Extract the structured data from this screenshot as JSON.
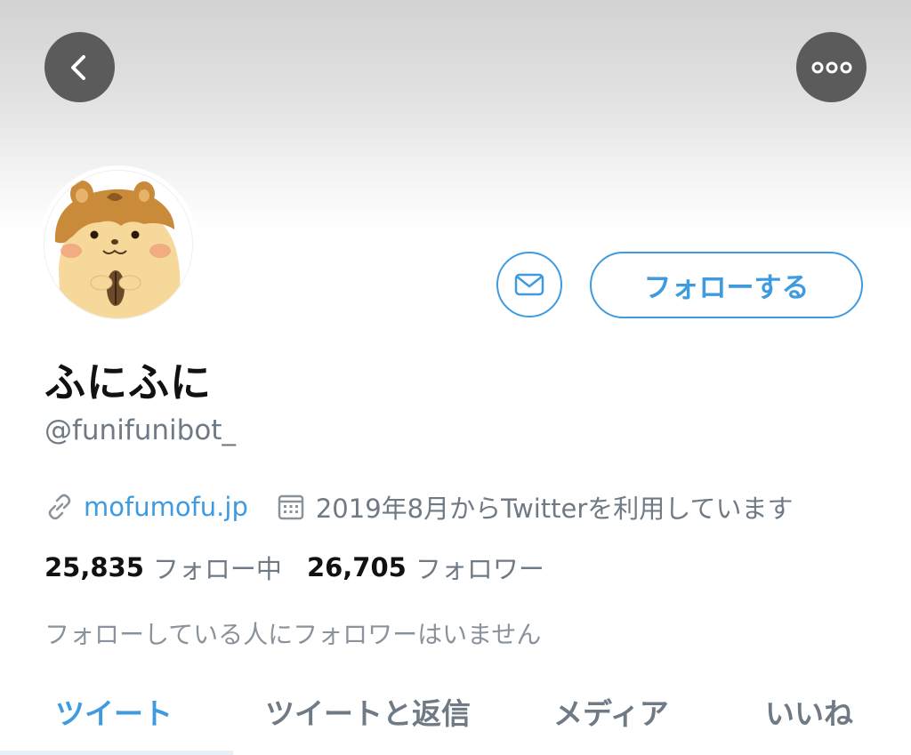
{
  "profile": {
    "display_name": "ふにふに",
    "handle": "@funifunibot_",
    "website": "mofumofu.jp",
    "joined": "2019年8月からTwitterを利用しています",
    "following_count": "25,835",
    "following_label": "フォロー中",
    "followers_count": "26,705",
    "followers_label": "フォロワー",
    "mutual_note": "フォローしている人にフォロワーはいません"
  },
  "actions": {
    "follow_label": "フォローする"
  },
  "tabs": [
    {
      "label": "ツイート",
      "active": true
    },
    {
      "label": "ツイートと返信",
      "active": false
    },
    {
      "label": "メディア",
      "active": false
    },
    {
      "label": "いいね",
      "active": false
    }
  ],
  "icons": {
    "back": "chevron-left-icon",
    "more": "more-dots-icon",
    "message": "envelope-icon",
    "link": "link-icon",
    "calendar": "calendar-icon"
  },
  "colors": {
    "accent": "#3f9be0",
    "header_button": "#5b5b5b",
    "secondary_text": "#6f7a85",
    "primary_text": "#111111"
  }
}
